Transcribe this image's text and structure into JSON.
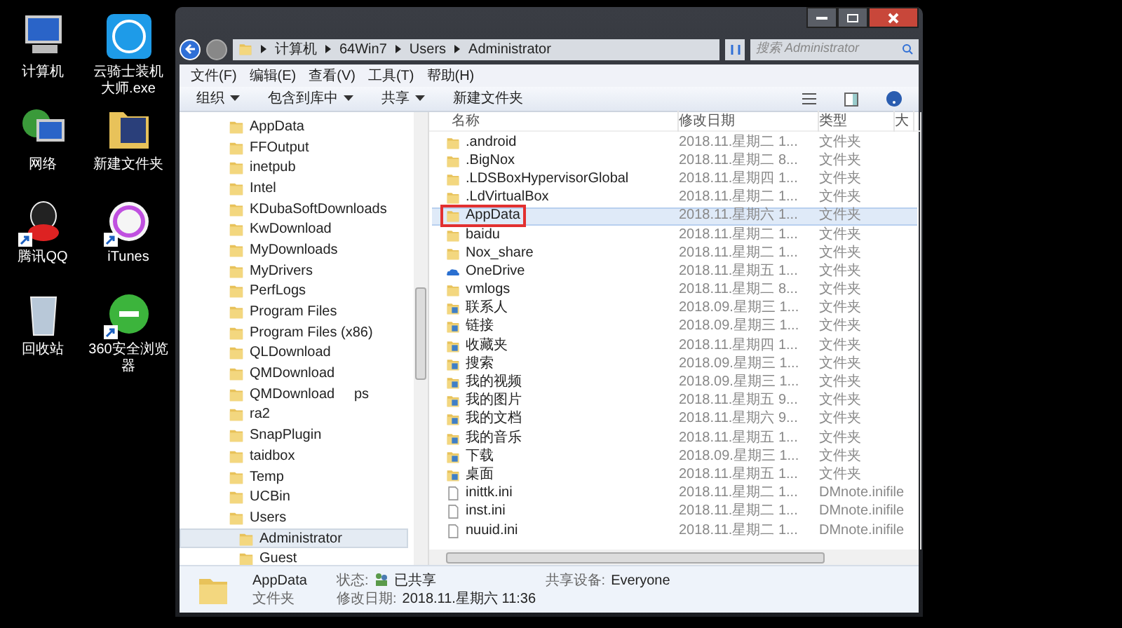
{
  "desktop_icons": [
    {
      "label": "计算机",
      "kind": "computer",
      "shortcut": false
    },
    {
      "label": "云骑士装机大师.exe",
      "kind": "app",
      "shortcut": false
    },
    {
      "label": "网络",
      "kind": "network",
      "shortcut": false
    },
    {
      "label": "新建文件夹",
      "kind": "folder",
      "shortcut": false
    },
    {
      "label": "腾讯QQ",
      "kind": "chat",
      "shortcut": true
    },
    {
      "label": "iTunes",
      "kind": "music",
      "shortcut": true
    },
    {
      "label": "回收站",
      "kind": "bin",
      "shortcut": false
    },
    {
      "label": "360安全浏览器",
      "kind": "browser",
      "shortcut": true
    }
  ],
  "window": {
    "breadcrumb": [
      "计算机",
      "64Win7",
      "Users",
      "Administrator"
    ],
    "search": {
      "placeholder": "搜索 Administrator"
    },
    "menu": [
      "文件(F)",
      "编辑(E)",
      "查看(V)",
      "工具(T)",
      "帮助(H)"
    ],
    "toolbar": [
      {
        "label": "组织",
        "dropdown": true
      },
      {
        "label": "包含到库中",
        "dropdown": true
      },
      {
        "label": "共享",
        "dropdown": true
      },
      {
        "label": "新建文件夹",
        "dropdown": false
      }
    ],
    "tree": [
      {
        "label": "AppData",
        "selected": false
      },
      {
        "label": "FFOutput",
        "selected": false
      },
      {
        "label": "inetpub",
        "selected": false
      },
      {
        "label": "Intel",
        "selected": false
      },
      {
        "label": "KDubaSoftDownloads",
        "selected": false
      },
      {
        "label": "KwDownload",
        "selected": false
      },
      {
        "label": "MyDownloads",
        "selected": false
      },
      {
        "label": "MyDrivers",
        "selected": false
      },
      {
        "label": "PerfLogs",
        "selected": false
      },
      {
        "label": "Program Files",
        "selected": false
      },
      {
        "label": "Program Files (x86)",
        "selected": false
      },
      {
        "label": "QLDownload",
        "selected": false
      },
      {
        "label": "QMDownload",
        "selected": false
      },
      {
        "label": "QMDownload     ps",
        "selected": false
      },
      {
        "label": "ra2",
        "selected": false
      },
      {
        "label": "SnapPlugin",
        "selected": false
      },
      {
        "label": "taidbox",
        "selected": false
      },
      {
        "label": "Temp",
        "selected": false
      },
      {
        "label": "UCBin",
        "selected": false
      },
      {
        "label": "Users",
        "selected": false,
        "children": [
          {
            "label": "Administrator",
            "selected": true
          },
          {
            "label": "Guest",
            "selected": false
          }
        ]
      }
    ],
    "columns": [
      "名称",
      "修改日期",
      "类型",
      "大"
    ],
    "files": [
      {
        "name": ".android",
        "date": "2018.11.星期二 1...",
        "type": "文件夹",
        "kind": "folder",
        "selected": false,
        "outlined": false
      },
      {
        "name": ".BigNox",
        "date": "2018.11.星期二 8...",
        "type": "文件夹",
        "kind": "folder",
        "selected": false,
        "outlined": false
      },
      {
        "name": ".LDSBoxHypervisorGlobal",
        "date": "2018.11.星期四 1...",
        "type": "文件夹",
        "kind": "folder",
        "selected": false,
        "outlined": false
      },
      {
        "name": ".LdVirtualBox",
        "date": "2018.11.星期二 1...",
        "type": "文件夹",
        "kind": "folder",
        "selected": false,
        "outlined": false
      },
      {
        "name": "AppData",
        "date": "2018.11.星期六 1...",
        "type": "文件夹",
        "kind": "folder",
        "selected": true,
        "outlined": true
      },
      {
        "name": "baidu",
        "date": "2018.11.星期二 1...",
        "type": "文件夹",
        "kind": "folder",
        "selected": false,
        "outlined": false
      },
      {
        "name": "Nox_share",
        "date": "2018.11.星期二 1...",
        "type": "文件夹",
        "kind": "folder",
        "selected": false,
        "outlined": false
      },
      {
        "name": "OneDrive",
        "date": "2018.11.星期五 1...",
        "type": "文件夹",
        "kind": "cloud",
        "selected": false,
        "outlined": false
      },
      {
        "name": "vmlogs",
        "date": "2018.11.星期二 8...",
        "type": "文件夹",
        "kind": "folder",
        "selected": false,
        "outlined": false
      },
      {
        "name": "联系人",
        "date": "2018.09.星期三 1...",
        "type": "文件夹",
        "kind": "special",
        "selected": false,
        "outlined": false
      },
      {
        "name": "链接",
        "date": "2018.09.星期三 1...",
        "type": "文件夹",
        "kind": "special",
        "selected": false,
        "outlined": false
      },
      {
        "name": "收藏夹",
        "date": "2018.11.星期四 1...",
        "type": "文件夹",
        "kind": "special",
        "selected": false,
        "outlined": false
      },
      {
        "name": "搜索",
        "date": "2018.09.星期三 1...",
        "type": "文件夹",
        "kind": "special",
        "selected": false,
        "outlined": false
      },
      {
        "name": "我的视频",
        "date": "2018.09.星期三 1...",
        "type": "文件夹",
        "kind": "special",
        "selected": false,
        "outlined": false
      },
      {
        "name": "我的图片",
        "date": "2018.11.星期五 9...",
        "type": "文件夹",
        "kind": "special",
        "selected": false,
        "outlined": false
      },
      {
        "name": "我的文档",
        "date": "2018.11.星期六 9...",
        "type": "文件夹",
        "kind": "special",
        "selected": false,
        "outlined": false
      },
      {
        "name": "我的音乐",
        "date": "2018.11.星期五 1...",
        "type": "文件夹",
        "kind": "special",
        "selected": false,
        "outlined": false
      },
      {
        "name": "下载",
        "date": "2018.09.星期三 1...",
        "type": "文件夹",
        "kind": "special",
        "selected": false,
        "outlined": false
      },
      {
        "name": "桌面",
        "date": "2018.11.星期五 1...",
        "type": "文件夹",
        "kind": "special",
        "selected": false,
        "outlined": false
      },
      {
        "name": "inittk.ini",
        "date": "2018.11.星期二 1...",
        "type": "DMnote.inifile",
        "kind": "file",
        "selected": false,
        "outlined": false
      },
      {
        "name": "inst.ini",
        "date": "2018.11.星期二 1...",
        "type": "DMnote.inifile",
        "kind": "file",
        "selected": false,
        "outlined": false
      },
      {
        "name": "nuuid.ini",
        "date": "2018.11.星期二 1...",
        "type": "DMnote.inifile",
        "kind": "file",
        "selected": false,
        "outlined": false
      }
    ],
    "details": {
      "name": "AppData",
      "type": "文件夹",
      "status_label": "状态:",
      "status": "已共享",
      "share_label": "共享设备:",
      "share": "Everyone",
      "modified_label": "修改日期:",
      "modified": "2018.11.星期六 11:36"
    }
  }
}
